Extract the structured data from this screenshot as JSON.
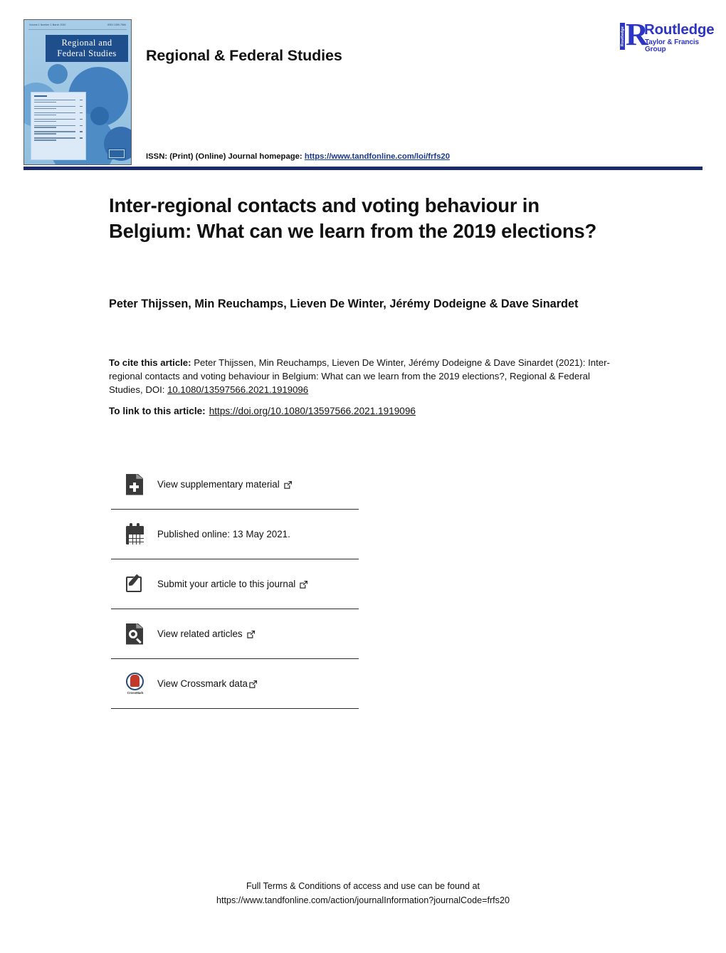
{
  "header": {
    "journal_title": "Regional & Federal Studies",
    "cover": {
      "title_line1": "Regional and",
      "title_line2": "Federal Studies",
      "top_left_meta": "Volume 1  Number 1  March 2020",
      "top_right_meta": "ISSN 1359-7566",
      "toc_heading": "Contents",
      "publisher_badge": "Routledge"
    },
    "publisher": {
      "spine_text": "Routledge",
      "initial": "R",
      "name": "Routledge",
      "tagline": "Taylor & Francis Group",
      "color": "#2d35c4"
    },
    "issn_prefix": "ISSN: (Print) (Online) Journal homepage:",
    "homepage_url": "https://www.tandfonline.com/loi/frfs20",
    "rule_color": "#1b2a6b"
  },
  "article": {
    "title": "Inter-regional contacts and voting behaviour in Belgium: What can we learn from the 2019 elections?",
    "authors": "Peter Thijssen, Min Reuchamps, Lieven De Winter, Jérémy Dodeigne & Dave Sinardet",
    "cite_label": "To cite this article:",
    "cite_body": " Peter Thijssen, Min Reuchamps, Lieven De Winter, Jérémy Dodeigne & Dave Sinardet (2021): Inter-regional contacts and voting behaviour in Belgium: What can we learn from the 2019 elections?, Regional & Federal Studies, DOI: ",
    "cite_doi": "10.1080/13597566.2021.1919096",
    "link_label": "To link to this article:",
    "link_url": "https://doi.org/10.1080/13597566.2021.1919096"
  },
  "actions": [
    {
      "icon": "document-plus-icon",
      "label": "View supplementary material",
      "external": true
    },
    {
      "icon": "calendar-icon",
      "label": "Published online: 13 May 2021.",
      "external": false
    },
    {
      "icon": "submit-pencil-icon",
      "label": "Submit your article to this journal",
      "external": true
    },
    {
      "icon": "related-articles-icon",
      "label": "View related articles",
      "external": true
    },
    {
      "icon": "crossmark-icon",
      "label": "View Crossmark data",
      "external": true
    }
  ],
  "footer": {
    "line1": "Full Terms & Conditions of access and use can be found at",
    "line2": "https://www.tandfonline.com/action/journalInformation?journalCode=frfs20"
  }
}
